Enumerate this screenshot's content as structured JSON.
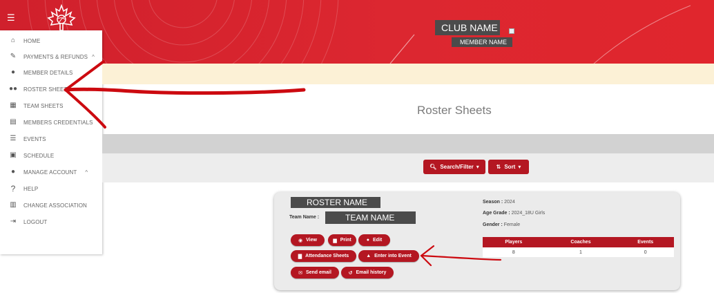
{
  "header": {
    "club_name": "CLUB NAME",
    "member_name": "MEMBER NAME",
    "brand_color": "#d92029"
  },
  "sidebar": {
    "items": [
      {
        "label": "HOME",
        "icon": "home-icon"
      },
      {
        "label": "PAYMENTS & REFUNDS",
        "icon": "edit-icon",
        "chevron": "^"
      },
      {
        "label": "MEMBER DETAILS",
        "icon": "user-icon"
      },
      {
        "label": "ROSTER SHEETS",
        "icon": "users-icon"
      },
      {
        "label": "TEAM SHEETS",
        "icon": "calendar-icon"
      },
      {
        "label": "MEMBERS CREDENTIALS",
        "icon": "id-card-icon"
      },
      {
        "label": "EVENTS",
        "icon": "list-icon"
      },
      {
        "label": "SCHEDULE",
        "icon": "clipboard-icon"
      },
      {
        "label": "MANAGE ACCOUNT",
        "icon": "user-icon",
        "chevron": "^"
      },
      {
        "label": "HELP",
        "icon": "question-icon"
      },
      {
        "label": "CHANGE ASSOCIATION",
        "icon": "building-icon"
      },
      {
        "label": "LOGOUT",
        "icon": "logout-icon"
      }
    ]
  },
  "page": {
    "title": "Roster Sheets"
  },
  "toolbar": {
    "search_label": "Search/Filter",
    "sort_label": "Sort"
  },
  "card": {
    "roster_name": "ROSTER NAME",
    "team_label": "Team Name :",
    "team_name": "TEAM NAME",
    "buttons": {
      "view": "View",
      "print": "Print",
      "edit": "Edit",
      "attendance": "Attendance Sheets",
      "enter_event": "Enter into Event",
      "send_email": "Send email",
      "email_history": "Email history"
    },
    "season_label": "Season :",
    "season_value": "2024",
    "age_grade_label": "Age Grade :",
    "age_grade_value": "2024_18U Girls",
    "gender_label": "Gender :",
    "gender_value": "Female",
    "stats": {
      "headers": [
        "Players",
        "Coaches",
        "Events"
      ],
      "values": [
        "8",
        "1",
        "0"
      ]
    }
  },
  "annotation_color": "#cc0a10"
}
